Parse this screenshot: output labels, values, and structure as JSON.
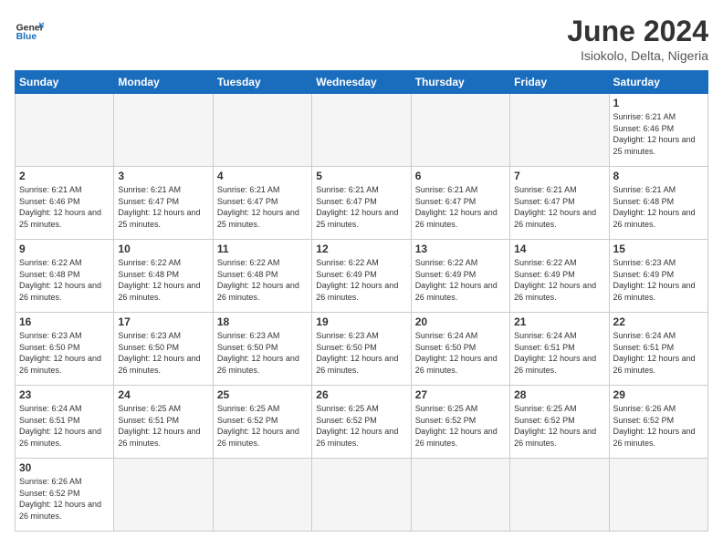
{
  "header": {
    "logo_general": "General",
    "logo_blue": "Blue",
    "title": "June 2024",
    "subtitle": "Isiokolo, Delta, Nigeria"
  },
  "days_of_week": [
    "Sunday",
    "Monday",
    "Tuesday",
    "Wednesday",
    "Thursday",
    "Friday",
    "Saturday"
  ],
  "weeks": [
    [
      {
        "day": "",
        "empty": true
      },
      {
        "day": "",
        "empty": true
      },
      {
        "day": "",
        "empty": true
      },
      {
        "day": "",
        "empty": true
      },
      {
        "day": "",
        "empty": true
      },
      {
        "day": "",
        "empty": true
      },
      {
        "day": "1",
        "sunrise": "6:21 AM",
        "sunset": "6:46 PM",
        "daylight": "12 hours and 25 minutes."
      }
    ],
    [
      {
        "day": "2",
        "sunrise": "6:21 AM",
        "sunset": "6:46 PM",
        "daylight": "12 hours and 25 minutes."
      },
      {
        "day": "3",
        "sunrise": "6:21 AM",
        "sunset": "6:47 PM",
        "daylight": "12 hours and 25 minutes."
      },
      {
        "day": "4",
        "sunrise": "6:21 AM",
        "sunset": "6:47 PM",
        "daylight": "12 hours and 25 minutes."
      },
      {
        "day": "5",
        "sunrise": "6:21 AM",
        "sunset": "6:47 PM",
        "daylight": "12 hours and 25 minutes."
      },
      {
        "day": "6",
        "sunrise": "6:21 AM",
        "sunset": "6:47 PM",
        "daylight": "12 hours and 26 minutes."
      },
      {
        "day": "7",
        "sunrise": "6:21 AM",
        "sunset": "6:47 PM",
        "daylight": "12 hours and 26 minutes."
      },
      {
        "day": "8",
        "sunrise": "6:21 AM",
        "sunset": "6:48 PM",
        "daylight": "12 hours and 26 minutes."
      }
    ],
    [
      {
        "day": "9",
        "sunrise": "6:22 AM",
        "sunset": "6:48 PM",
        "daylight": "12 hours and 26 minutes."
      },
      {
        "day": "10",
        "sunrise": "6:22 AM",
        "sunset": "6:48 PM",
        "daylight": "12 hours and 26 minutes."
      },
      {
        "day": "11",
        "sunrise": "6:22 AM",
        "sunset": "6:48 PM",
        "daylight": "12 hours and 26 minutes."
      },
      {
        "day": "12",
        "sunrise": "6:22 AM",
        "sunset": "6:49 PM",
        "daylight": "12 hours and 26 minutes."
      },
      {
        "day": "13",
        "sunrise": "6:22 AM",
        "sunset": "6:49 PM",
        "daylight": "12 hours and 26 minutes."
      },
      {
        "day": "14",
        "sunrise": "6:22 AM",
        "sunset": "6:49 PM",
        "daylight": "12 hours and 26 minutes."
      },
      {
        "day": "15",
        "sunrise": "6:23 AM",
        "sunset": "6:49 PM",
        "daylight": "12 hours and 26 minutes."
      }
    ],
    [
      {
        "day": "16",
        "sunrise": "6:23 AM",
        "sunset": "6:50 PM",
        "daylight": "12 hours and 26 minutes."
      },
      {
        "day": "17",
        "sunrise": "6:23 AM",
        "sunset": "6:50 PM",
        "daylight": "12 hours and 26 minutes."
      },
      {
        "day": "18",
        "sunrise": "6:23 AM",
        "sunset": "6:50 PM",
        "daylight": "12 hours and 26 minutes."
      },
      {
        "day": "19",
        "sunrise": "6:23 AM",
        "sunset": "6:50 PM",
        "daylight": "12 hours and 26 minutes."
      },
      {
        "day": "20",
        "sunrise": "6:24 AM",
        "sunset": "6:50 PM",
        "daylight": "12 hours and 26 minutes."
      },
      {
        "day": "21",
        "sunrise": "6:24 AM",
        "sunset": "6:51 PM",
        "daylight": "12 hours and 26 minutes."
      },
      {
        "day": "22",
        "sunrise": "6:24 AM",
        "sunset": "6:51 PM",
        "daylight": "12 hours and 26 minutes."
      }
    ],
    [
      {
        "day": "23",
        "sunrise": "6:24 AM",
        "sunset": "6:51 PM",
        "daylight": "12 hours and 26 minutes."
      },
      {
        "day": "24",
        "sunrise": "6:25 AM",
        "sunset": "6:51 PM",
        "daylight": "12 hours and 26 minutes."
      },
      {
        "day": "25",
        "sunrise": "6:25 AM",
        "sunset": "6:52 PM",
        "daylight": "12 hours and 26 minutes."
      },
      {
        "day": "26",
        "sunrise": "6:25 AM",
        "sunset": "6:52 PM",
        "daylight": "12 hours and 26 minutes."
      },
      {
        "day": "27",
        "sunrise": "6:25 AM",
        "sunset": "6:52 PM",
        "daylight": "12 hours and 26 minutes."
      },
      {
        "day": "28",
        "sunrise": "6:25 AM",
        "sunset": "6:52 PM",
        "daylight": "12 hours and 26 minutes."
      },
      {
        "day": "29",
        "sunrise": "6:26 AM",
        "sunset": "6:52 PM",
        "daylight": "12 hours and 26 minutes."
      }
    ],
    [
      {
        "day": "30",
        "sunrise": "6:26 AM",
        "sunset": "6:52 PM",
        "daylight": "12 hours and 26 minutes."
      },
      {
        "day": "",
        "empty": true
      },
      {
        "day": "",
        "empty": true
      },
      {
        "day": "",
        "empty": true
      },
      {
        "day": "",
        "empty": true
      },
      {
        "day": "",
        "empty": true
      },
      {
        "day": "",
        "empty": true
      }
    ]
  ]
}
